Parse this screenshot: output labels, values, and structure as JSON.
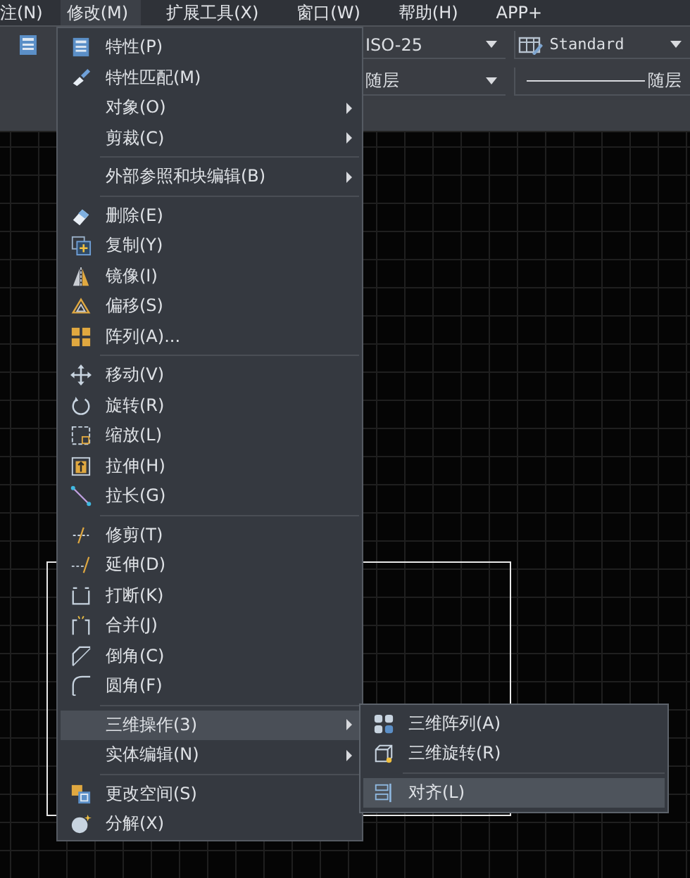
{
  "menubar": [
    {
      "label": "注(N)",
      "selected": false
    },
    {
      "label": "修改(M)",
      "selected": true
    },
    {
      "label": "扩展工具(X)",
      "selected": false
    },
    {
      "label": "窗口(W)",
      "selected": false
    },
    {
      "label": "帮助(H)",
      "selected": false
    },
    {
      "label": "APP+",
      "selected": false
    }
  ],
  "toolbar": {
    "dimstyle": "ISO-25",
    "tablestyle": "Standard",
    "layer_combo": "随层",
    "linetype": "随层"
  },
  "menu": {
    "groups": [
      [
        {
          "label": "特性(P)",
          "submenu": false,
          "selected": false
        },
        {
          "label": "特性匹配(M)",
          "submenu": false,
          "selected": false
        },
        {
          "label": "对象(O)",
          "submenu": true,
          "selected": false
        },
        {
          "label": "剪裁(C)",
          "submenu": true,
          "selected": false
        }
      ],
      [
        {
          "label": "外部参照和块编辑(B)",
          "submenu": true,
          "selected": false
        }
      ],
      [
        {
          "label": "删除(E)",
          "submenu": false,
          "selected": false
        },
        {
          "label": "复制(Y)",
          "submenu": false,
          "selected": false
        },
        {
          "label": "镜像(I)",
          "submenu": false,
          "selected": false
        },
        {
          "label": "偏移(S)",
          "submenu": false,
          "selected": false
        },
        {
          "label": "阵列(A)...",
          "submenu": false,
          "selected": false
        }
      ],
      [
        {
          "label": "移动(V)",
          "submenu": false,
          "selected": false
        },
        {
          "label": "旋转(R)",
          "submenu": false,
          "selected": false
        },
        {
          "label": "缩放(L)",
          "submenu": false,
          "selected": false
        },
        {
          "label": "拉伸(H)",
          "submenu": false,
          "selected": false
        },
        {
          "label": "拉长(G)",
          "submenu": false,
          "selected": false
        }
      ],
      [
        {
          "label": "修剪(T)",
          "submenu": false,
          "selected": false
        },
        {
          "label": "延伸(D)",
          "submenu": false,
          "selected": false
        },
        {
          "label": "打断(K)",
          "submenu": false,
          "selected": false
        },
        {
          "label": "合并(J)",
          "submenu": false,
          "selected": false
        },
        {
          "label": "倒角(C)",
          "submenu": false,
          "selected": false
        },
        {
          "label": "圆角(F)",
          "submenu": false,
          "selected": false
        }
      ],
      [
        {
          "label": "三维操作(3)",
          "submenu": true,
          "selected": true
        },
        {
          "label": "实体编辑(N)",
          "submenu": true,
          "selected": false
        }
      ],
      [
        {
          "label": "更改空间(S)",
          "submenu": false,
          "selected": false
        },
        {
          "label": "分解(X)",
          "submenu": false,
          "selected": false
        }
      ]
    ]
  },
  "submenu": {
    "groups": [
      [
        {
          "label": "三维阵列(A)",
          "selected": false
        },
        {
          "label": "三维旋转(R)",
          "selected": false
        }
      ],
      [
        {
          "label": "对齐(L)",
          "selected": true
        }
      ]
    ]
  }
}
